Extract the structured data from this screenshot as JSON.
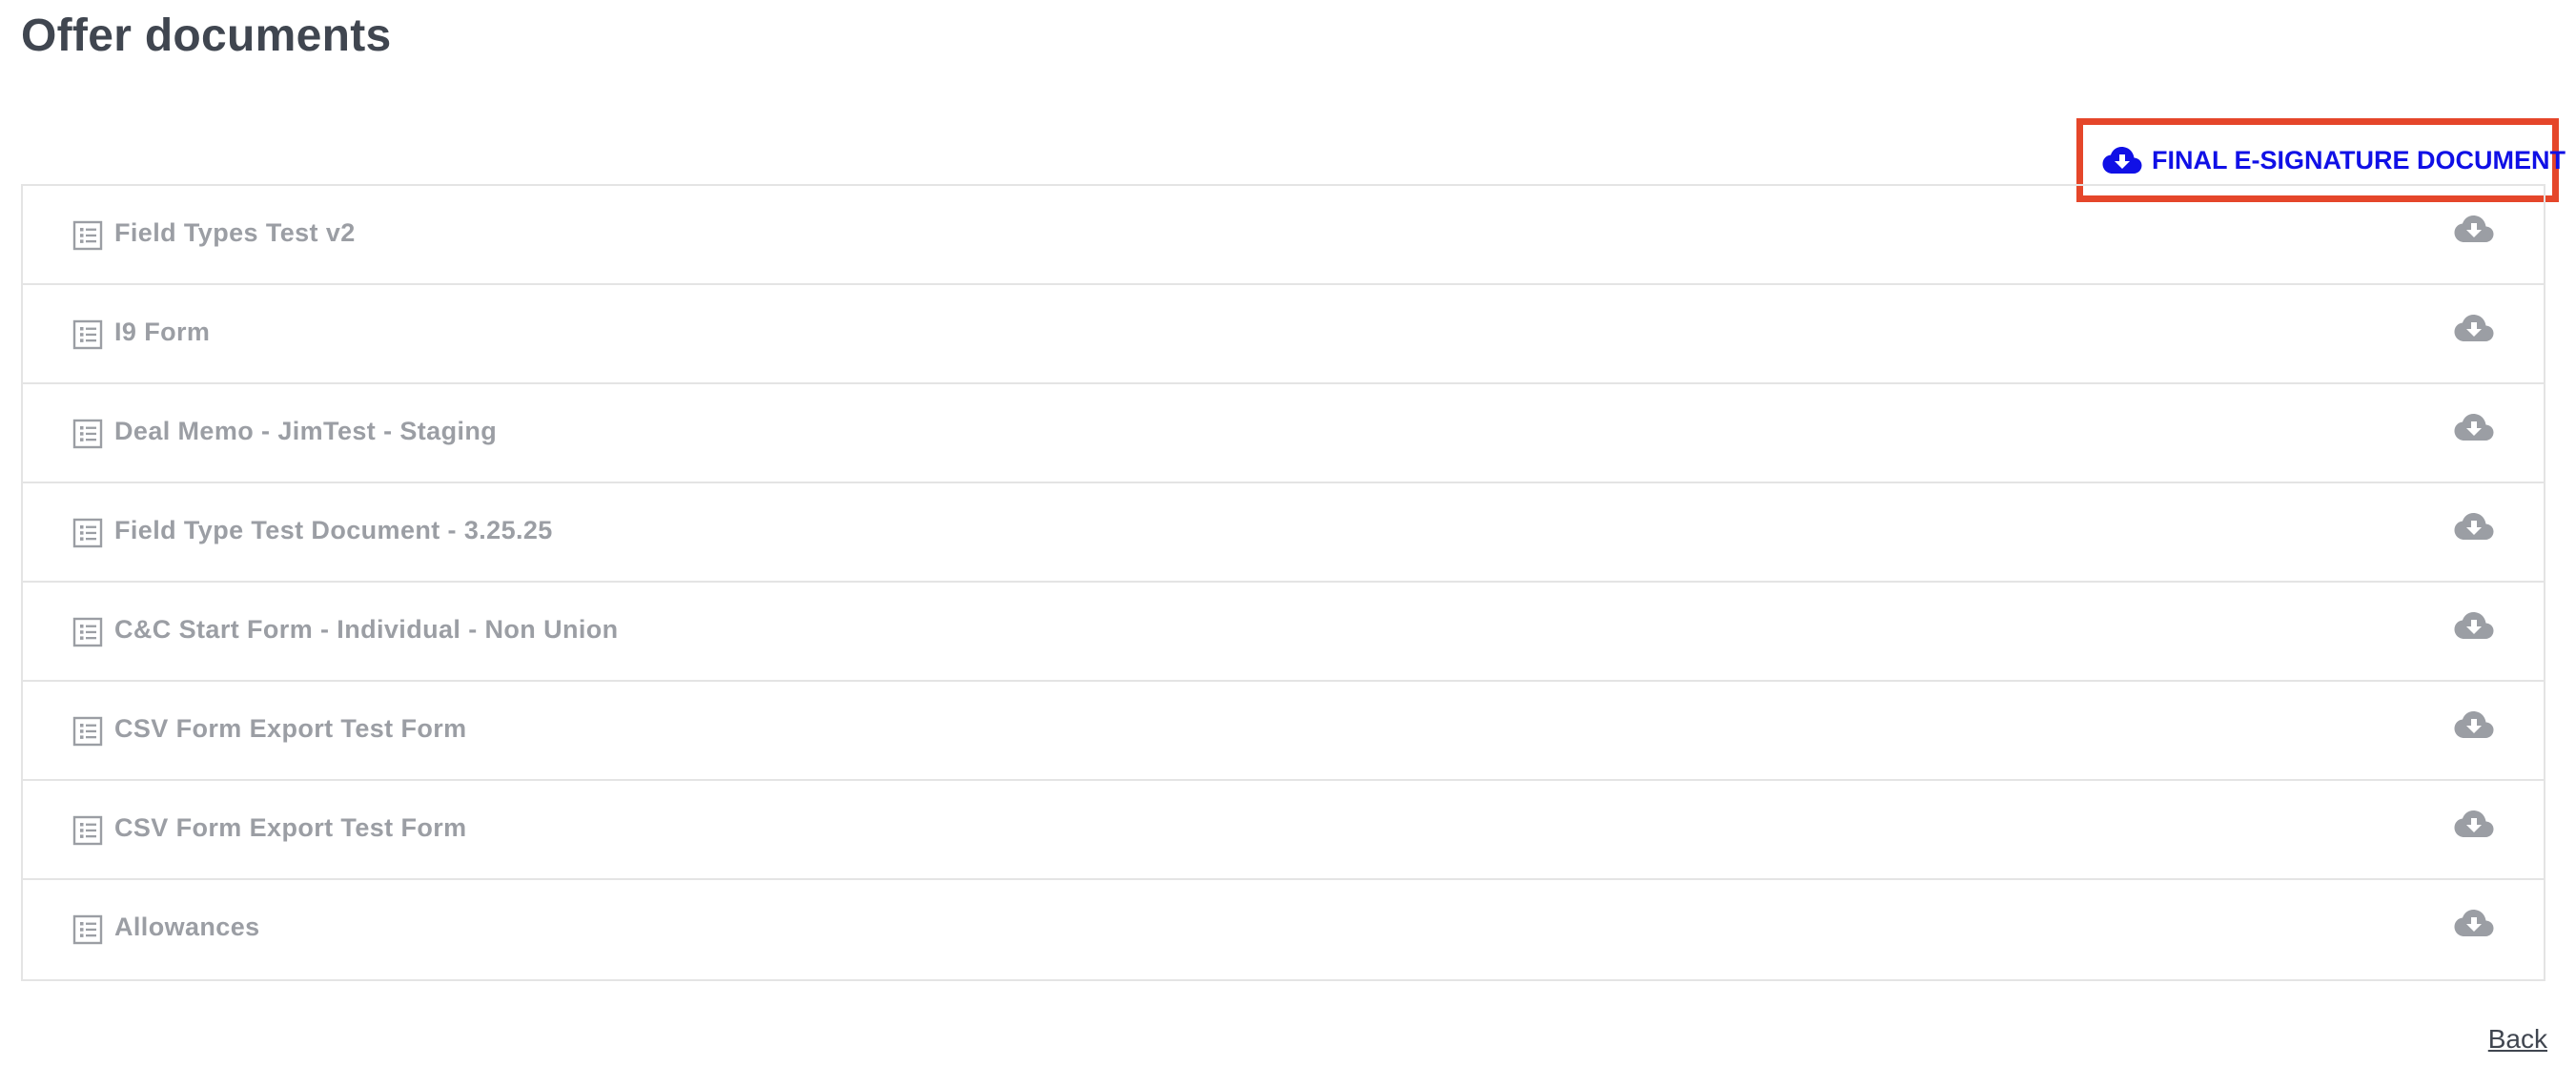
{
  "page": {
    "title": "Offer documents"
  },
  "actions": {
    "final_esignature_label": "FINAL E-SIGNATURE DOCUMENT",
    "back_label": "Back"
  },
  "colors": {
    "accent_blue": "#1010e6",
    "highlight_red": "#e5462a",
    "muted_text": "#9b9ea4",
    "title_text": "#404650"
  },
  "icons": {
    "row_icon": "list-document-icon",
    "row_action_icon": "cloud-download-icon",
    "final_icon": "cloud-download-icon"
  },
  "documents": [
    {
      "name": "Field Types Test v2"
    },
    {
      "name": "I9 Form"
    },
    {
      "name": "Deal Memo - JimTest - Staging"
    },
    {
      "name": "Field Type Test Document - 3.25.25"
    },
    {
      "name": "C&C Start Form - Individual - Non Union"
    },
    {
      "name": "CSV Form Export Test Form"
    },
    {
      "name": "CSV Form Export Test Form"
    },
    {
      "name": "Allowances"
    }
  ]
}
